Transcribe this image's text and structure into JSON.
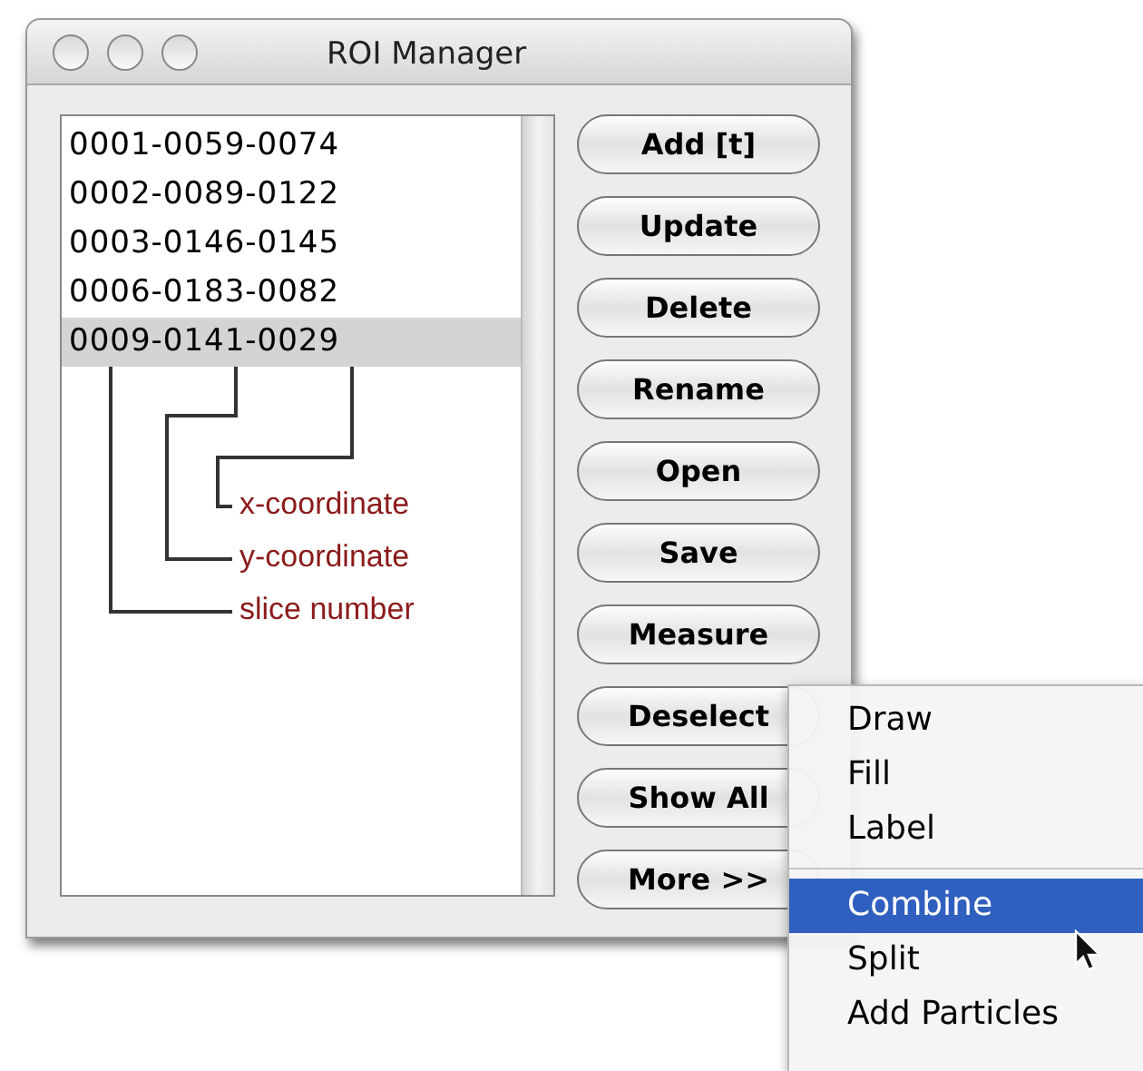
{
  "window": {
    "title": "ROI Manager"
  },
  "list": {
    "items": [
      {
        "label": "0001-0059-0074",
        "selected": false
      },
      {
        "label": "0002-0089-0122",
        "selected": false
      },
      {
        "label": "0003-0146-0145",
        "selected": false
      },
      {
        "label": "0006-0183-0082",
        "selected": false
      },
      {
        "label": "0009-0141-0029",
        "selected": true
      }
    ]
  },
  "annotations": [
    "x-coordinate",
    "y-coordinate",
    "slice number"
  ],
  "buttons": [
    "Add [t]",
    "Update",
    "Delete",
    "Rename",
    "Open",
    "Save",
    "Measure",
    "Deselect",
    "Show All",
    "More >>"
  ],
  "menu": {
    "items": [
      {
        "label": "Draw",
        "selected": false
      },
      {
        "label": "Fill",
        "selected": false
      },
      {
        "label": "Label",
        "selected": false
      },
      {
        "kind": "separator"
      },
      {
        "label": "Combine",
        "selected": true
      },
      {
        "label": "Split",
        "selected": false
      },
      {
        "label": "Add Particles",
        "selected": false
      }
    ]
  }
}
